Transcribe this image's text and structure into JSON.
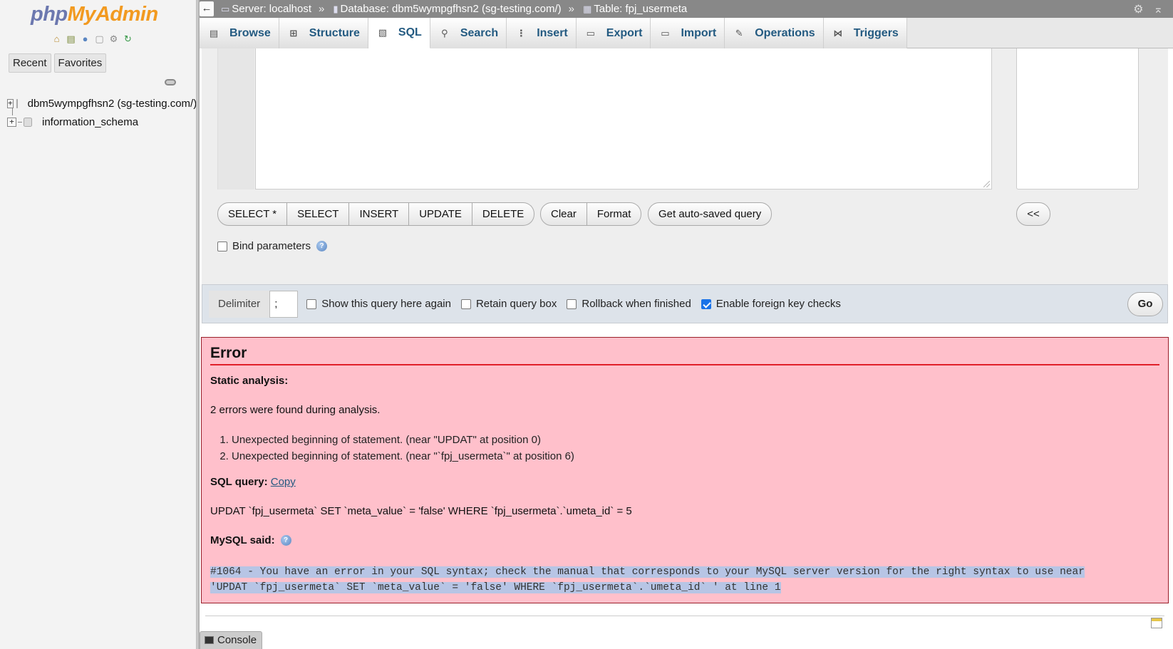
{
  "nav": {
    "logo_php": "php",
    "logo_myadmin": "MyAdmin",
    "icons": [
      "home-icon",
      "logout-icon",
      "help-icon",
      "docs-icon",
      "settings-icon",
      "reload-icon"
    ],
    "tabs": [
      "Recent",
      "Favorites"
    ],
    "databases": [
      "dbm5wympgfhsn2 (sg-testing.com/)",
      "information_schema"
    ]
  },
  "breadcrumb": {
    "server": "Server: localhost",
    "database": "Database: dbm5wympgfhsn2 (sg-testing.com/)",
    "table": "Table: fpj_usermeta",
    "separator": "»",
    "back": "←"
  },
  "tabs": [
    {
      "label": "Browse",
      "icon": "browse-icon"
    },
    {
      "label": "Structure",
      "icon": "structure-icon"
    },
    {
      "label": "SQL",
      "icon": "sql-icon",
      "active": true
    },
    {
      "label": "Search",
      "icon": "search-icon"
    },
    {
      "label": "Insert",
      "icon": "insert-icon"
    },
    {
      "label": "Export",
      "icon": "export-icon"
    },
    {
      "label": "Import",
      "icon": "import-icon"
    },
    {
      "label": "Operations",
      "icon": "operations-icon"
    },
    {
      "label": "Triggers",
      "icon": "triggers-icon"
    }
  ],
  "query": {
    "buttons_insert": [
      "SELECT *",
      "SELECT",
      "INSERT",
      "UPDATE",
      "DELETE"
    ],
    "buttons_tools": [
      "Clear",
      "Format"
    ],
    "autosave_label": "Get auto-saved query",
    "collapse_label": "<<",
    "bind_parameters": "Bind parameters"
  },
  "options": {
    "delimiter_label": "Delimiter",
    "delimiter_value": ";",
    "show_again": "Show this query here again",
    "retain_box": "Retain query box",
    "rollback": "Rollback when finished",
    "fk_checks": "Enable foreign key checks",
    "go": "Go"
  },
  "error": {
    "title": "Error",
    "static_analysis": "Static analysis:",
    "found": "2 errors were found during analysis.",
    "items": [
      "Unexpected beginning of statement. (near \"UPDAT\" at position 0)",
      "Unexpected beginning of statement. (near \"`fpj_usermeta`\" at position 6)"
    ],
    "sql_query_label": "SQL query:",
    "copy_link": "Copy",
    "sql_query": "UPDAT `fpj_usermeta` SET `meta_value` = 'false' WHERE `fpj_usermeta`.`umeta_id` = 5",
    "mysql_said_label": "MySQL said:",
    "mysql_line1": "#1064 - You have an error in your SQL syntax; check the manual that corresponds to your MySQL server version for the right syntax to use near",
    "mysql_line2": "'UPDAT `fpj_usermeta` SET `meta_value` = 'false' WHERE `fpj_usermeta`.`umeta_id` ' at line 1"
  },
  "console": {
    "label": "Console"
  },
  "colors": {
    "error_bg": "#ffc0cb",
    "error_rule": "#e0202a",
    "tab_text": "#235a81",
    "options_bg": "#dde3ea"
  }
}
